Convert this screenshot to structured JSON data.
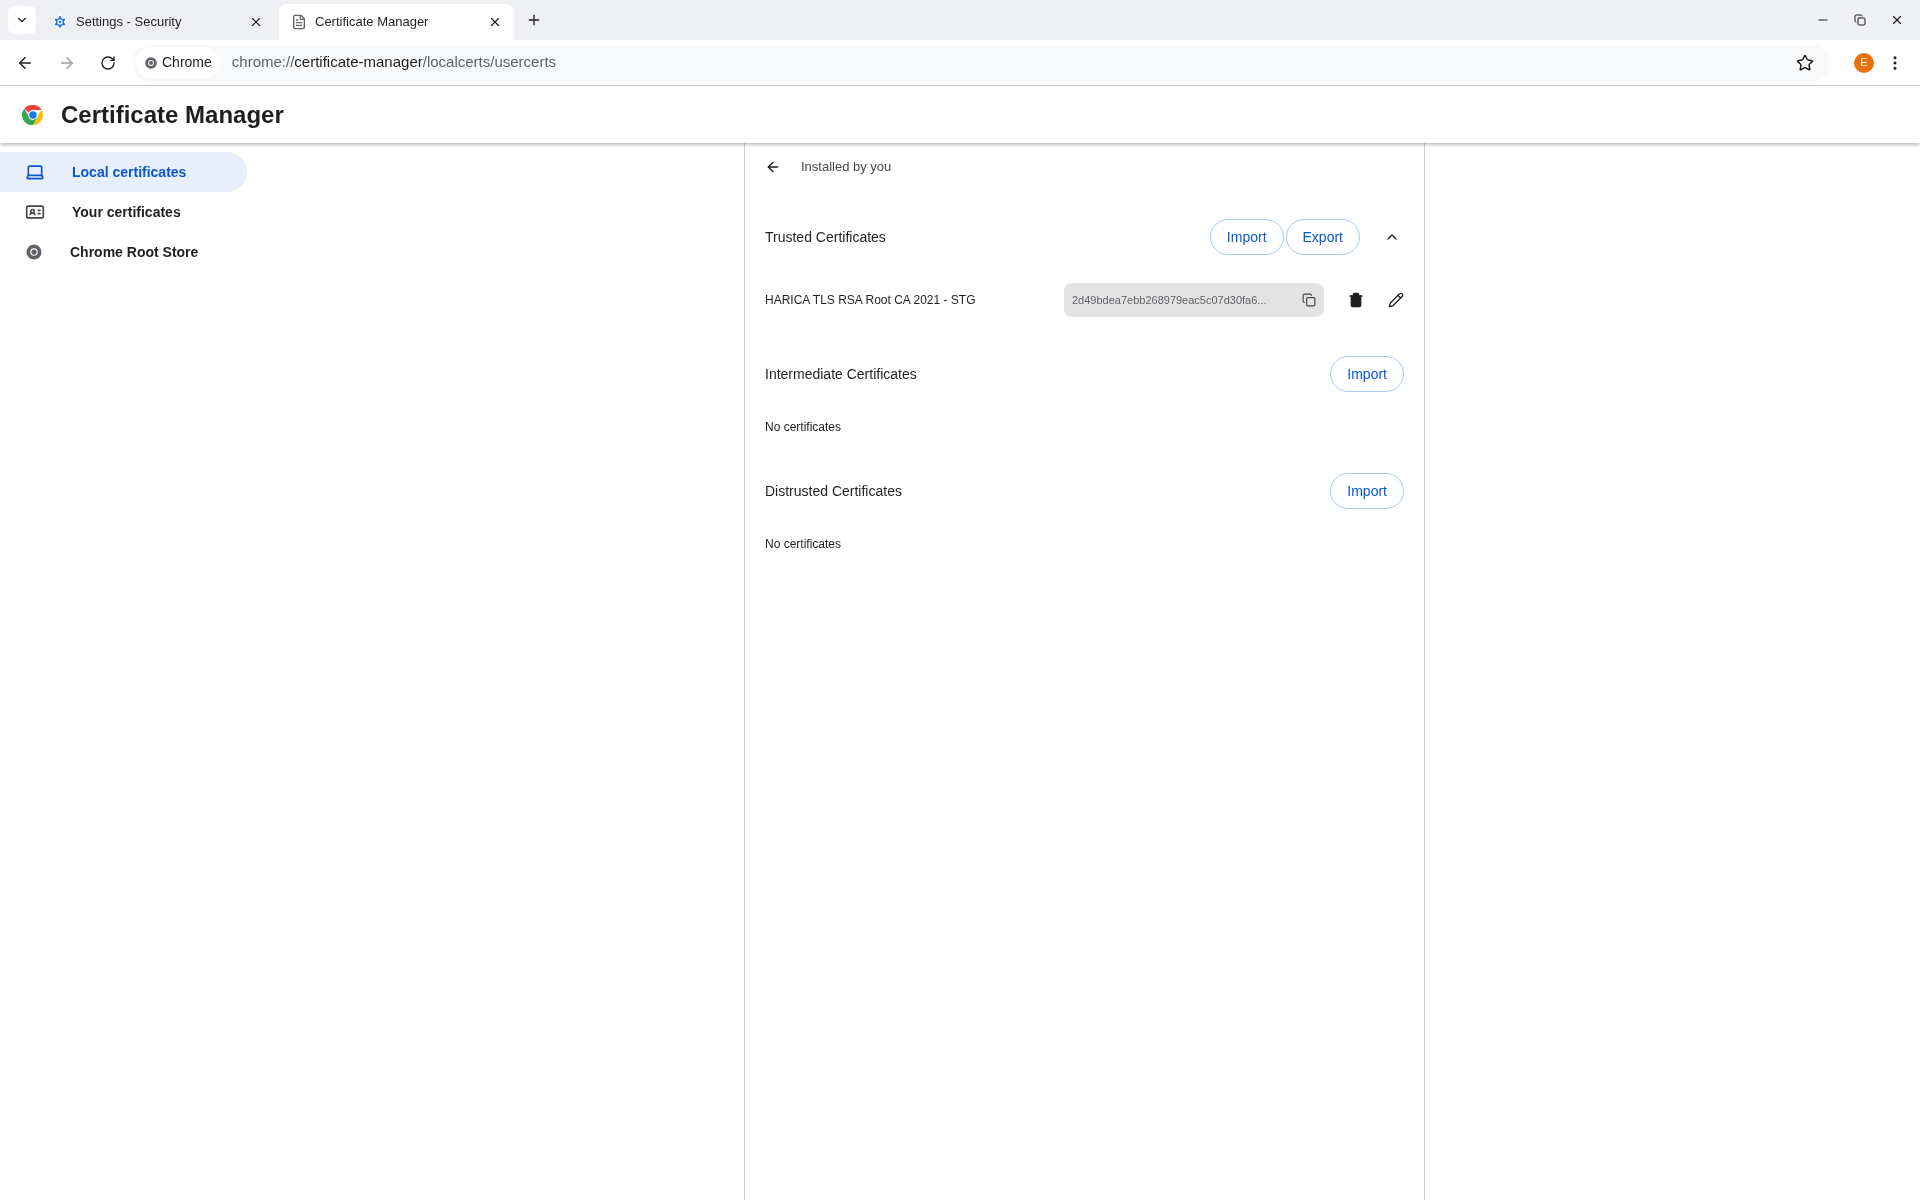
{
  "tabs": [
    {
      "title": "Settings - Security",
      "selected": false
    },
    {
      "title": "Certificate Manager",
      "selected": true
    }
  ],
  "address_bar": {
    "chip": "Chrome",
    "url_scheme": "chrome://",
    "url_host": "certificate-manager",
    "url_path": "/localcerts/usercerts",
    "avatar_letter": "E"
  },
  "page_title": "Certificate Manager",
  "sidebar": {
    "items": [
      {
        "label": "Local certificates",
        "selected": true
      },
      {
        "label": "Your certificates",
        "selected": false
      },
      {
        "label": "Chrome Root Store",
        "selected": false
      }
    ]
  },
  "panel": {
    "heading": "Installed by you",
    "sections": [
      {
        "title": "Trusted Certificates",
        "buttons": [
          "Import",
          "Export"
        ],
        "expanded": true,
        "certificates": [
          {
            "name": "HARICA TLS RSA Root CA 2021 - STG",
            "hash": "2d49bdea7ebb268979eac5c07d30fa6..."
          }
        ]
      },
      {
        "title": "Intermediate Certificates",
        "buttons": [
          "Import"
        ],
        "empty_text": "No certificates"
      },
      {
        "title": "Distrusted Certificates",
        "buttons": [
          "Import"
        ],
        "empty_text": "No certificates"
      }
    ]
  }
}
